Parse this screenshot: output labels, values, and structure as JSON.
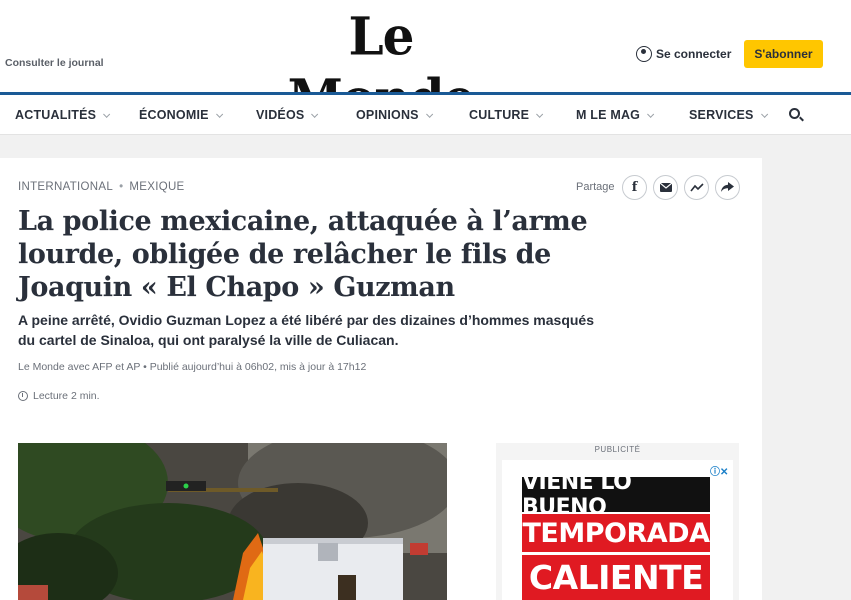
{
  "header": {
    "consulter": "Consulter le journal",
    "logo": "Le Monde",
    "connect": "Se connecter",
    "subscribe": "S'abonner"
  },
  "nav": {
    "items": [
      {
        "label": "ACTUALITÉS"
      },
      {
        "label": "ÉCONOMIE"
      },
      {
        "label": "VIDÉOS"
      },
      {
        "label": "OPINIONS"
      },
      {
        "label": "CULTURE"
      },
      {
        "label": "M LE MAG"
      },
      {
        "label": "SERVICES"
      }
    ]
  },
  "article": {
    "breadcrumb": [
      "INTERNATIONAL",
      "MEXIQUE"
    ],
    "share_label": "Partage",
    "title": "La police mexicaine, attaquée à l’arme lourde, obligée de relâcher le fils de Joaquin « El Chapo » Guzman",
    "lead": "A peine arrêté, Ovidio Guzman Lopez a été libéré par des dizaines d’hommes masqués du cartel de Sinaloa, qui ont paralysé la ville de Culiacan.",
    "author": "Le Monde avec AFP et AP",
    "published": "Publié aujourd’hui à 06h02, mis à jour à 17h12",
    "reading_time": "Lecture 2 min."
  },
  "ad": {
    "label": "PUBLICITÉ",
    "line1": "VIENE LO BUENO",
    "line2": "TEMPORADA",
    "line3": "CALIENTE"
  },
  "colors": {
    "accent_blue": "#1a5a96",
    "subscribe_yellow": "#ffc600",
    "ad_red": "#e01a22"
  }
}
